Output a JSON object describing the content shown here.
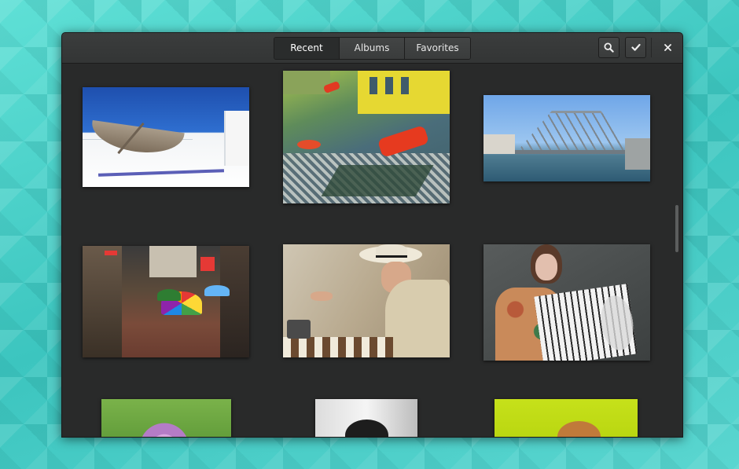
{
  "header": {
    "tabs": [
      {
        "label": "Recent",
        "active": true
      },
      {
        "label": "Albums",
        "active": false
      },
      {
        "label": "Favorites",
        "active": false
      }
    ],
    "search_icon": "search-icon",
    "select_icon": "checkmark-icon",
    "close_icon": "close-icon"
  },
  "colors": {
    "headerbar": "#363838",
    "content_bg": "#292a2a",
    "desktop": "#4fd1c9"
  }
}
